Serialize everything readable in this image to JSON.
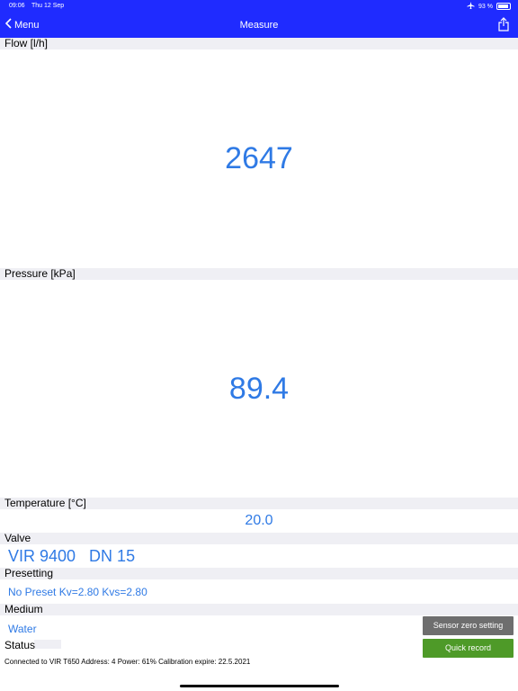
{
  "status_bar": {
    "time": "09:06",
    "date": "Thu 12 Sep",
    "battery": "93 %"
  },
  "nav": {
    "back_label": "Menu",
    "title": "Measure"
  },
  "flow": {
    "label": "Flow [l/h]",
    "value": "2647"
  },
  "pressure": {
    "label": "Pressure [kPa]",
    "value": "89.4"
  },
  "temperature": {
    "label": "Temperature [°C]",
    "value": "20.0"
  },
  "valve": {
    "label": "Valve",
    "value": "VIR 9400   DN 15"
  },
  "presetting": {
    "label": "Presetting",
    "value": "No Preset Kv=2.80 Kvs=2.80"
  },
  "medium": {
    "label": "Medium",
    "value": "Water"
  },
  "status": {
    "label": "Status",
    "connection": "Connected to VIR T650 Address: 4 Power: 61% Calibration expire: 22.5.2021"
  },
  "buttons": {
    "sensor_zero": "Sensor zero setting",
    "quick_record": "Quick record"
  },
  "colors": {
    "nav_bar": "#1f2bff",
    "value_text": "#2f7ae5",
    "section_header": "#efeff4",
    "gray_button": "#6e6e6e",
    "green_button": "#4e9a28"
  }
}
